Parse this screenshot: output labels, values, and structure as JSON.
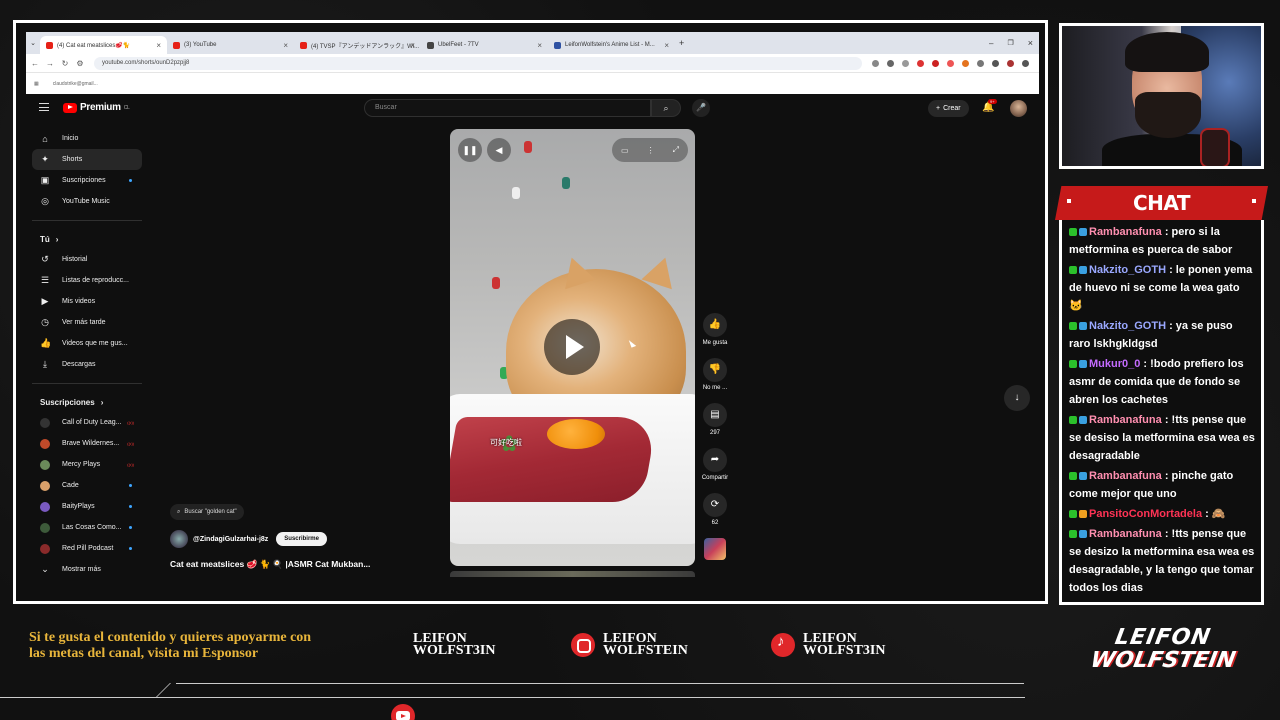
{
  "browser": {
    "tabs": [
      {
        "label": "(4) Cat eat meatslices🥩🐈",
        "color": "#e62117"
      },
      {
        "label": "(3) YouTube",
        "color": "#e62117"
      },
      {
        "label": "(4) TVSP『アンデッドアンラック』Wi...",
        "color": "#e62117"
      },
      {
        "label": "UbelFeet - 7TV",
        "color": "#444444"
      },
      {
        "label": "LeifonWolfstein's Anime List - M...",
        "color": "#2e51a2"
      }
    ],
    "url": "youtube.com/shorts/ounD2pzpjj8",
    "bookmark": "claudstrike@gmail..."
  },
  "youtube": {
    "logo_text": "Premium",
    "logo_sup": "CL",
    "search_placeholder": "Buscar",
    "create_label": "Crear",
    "notifications": "9+",
    "sidebar": {
      "main": [
        {
          "label": "Inicio",
          "icon": "⌂"
        },
        {
          "label": "Shorts",
          "icon": "✦"
        },
        {
          "label": "Suscripciones",
          "icon": "▣"
        },
        {
          "label": "YouTube Music",
          "icon": "◎"
        }
      ],
      "you_header": "Tú",
      "you": [
        {
          "label": "Historial",
          "icon": "↺"
        },
        {
          "label": "Listas de reproducc...",
          "icon": "☰"
        },
        {
          "label": "Mis videos",
          "icon": "▶"
        },
        {
          "label": "Ver más tarde",
          "icon": "◷"
        },
        {
          "label": "Videos que me gus...",
          "icon": "👍"
        },
        {
          "label": "Descargas",
          "icon": "⤓"
        }
      ],
      "subs_header": "Suscripciones",
      "subs": [
        {
          "label": "Call of Duty Leag...",
          "color": "#333333",
          "status": "live"
        },
        {
          "label": "Brave Wildernes...",
          "color": "#c04a2a",
          "status": "live"
        },
        {
          "label": "Mercy Plays",
          "color": "#6b8a5a",
          "status": "live"
        },
        {
          "label": "Cade",
          "color": "#d9a06a",
          "status": "new"
        },
        {
          "label": "BaityPlays",
          "color": "#7a5ac0",
          "status": "new"
        },
        {
          "label": "Las Cosas Como...",
          "color": "#3d5a3a",
          "status": "new"
        },
        {
          "label": "Red Pill Podcast",
          "color": "#8a2a2a",
          "status": "new"
        }
      ],
      "show_more": "Mostrar más"
    },
    "suggestion": "Buscar \"golden cat\"",
    "channel_handle": "@ZindagiGulzarhai-j8z",
    "subscribe_label": "Suscribirme",
    "video_title": "Cat eat meatslices 🥩 🐈 🍳 |ASMR Cat Mukban...",
    "video_overlay_text": "可好吃啦",
    "actions": {
      "like": "Me gusta",
      "dislike": "No me ...",
      "comments": "297",
      "share": "Compartir",
      "remix": "62"
    }
  },
  "chat": {
    "header": "CHAT",
    "messages": [
      {
        "user": "Rambanafuna",
        "color": "#ff8fb0",
        "text": ": pero si la metformina es puerca de sabor"
      },
      {
        "user": "Nakzito_GOTH",
        "color": "#9aa8ff",
        "text": ": le ponen yema de huevo ni se come la wea gato 🐱"
      },
      {
        "user": "Nakzito_GOTH",
        "color": "#9aa8ff",
        "text": ": ya se puso raro lskhgkldgsd"
      },
      {
        "user": "Mukur0_0",
        "color": "#c46bff",
        "text": ": !bodo prefiero los asmr de comida que de fondo se abren los cachetes"
      },
      {
        "user": "Rambanafuna",
        "color": "#ff8fb0",
        "text": ": !tts pense que se desiso la metformina esa wea es desagradable"
      },
      {
        "user": "Rambanafuna",
        "color": "#ff8fb0",
        "text": ": pinche gato come mejor que uno"
      },
      {
        "user": "PansitoConMortadela",
        "color": "#ff3355",
        "text": ": 🙈"
      },
      {
        "user": "Rambanafuna",
        "color": "#ff8fb0",
        "text": ": !tts pense que se desizo la metformina esa wea es desagradable, y la tengo que tomar todos los dias"
      }
    ]
  },
  "overlay": {
    "sponsor_text": "Si te gusta el contenido y quieres apoyarme con las metas del canal, visita mi Esponsor",
    "social": [
      {
        "platform": "youtube",
        "line1": "LEIFON",
        "line2": "WOLFST3IN"
      },
      {
        "platform": "instagram",
        "line1": "LEIFON",
        "line2": "WOLFSTEIN"
      },
      {
        "platform": "tiktok",
        "line1": "LEIFON",
        "line2": "WOLFST3IN"
      }
    ],
    "brand_line1": "LEIFON",
    "brand_line2": "WOLFSTEIN"
  }
}
